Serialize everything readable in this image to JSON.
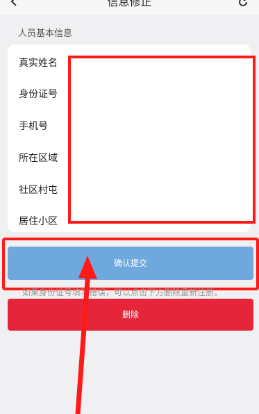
{
  "header": {
    "title": "信息修正"
  },
  "section": {
    "title": "人员基本信息"
  },
  "form": {
    "rows": [
      {
        "label": "真实姓名"
      },
      {
        "label": "身份证号"
      },
      {
        "label": "手机号"
      },
      {
        "label": "所在区域"
      },
      {
        "label": "社区村屯"
      },
      {
        "label": "居住小区"
      }
    ]
  },
  "actions": {
    "confirm_label": "确认提交",
    "hint": "如果身份证号填写错误，可以点击下方删除重新注册。",
    "delete_label": "删除"
  },
  "colors": {
    "confirm": "#6fa8dc",
    "delete": "#e5263a",
    "annotation": "#ff1a1a"
  }
}
